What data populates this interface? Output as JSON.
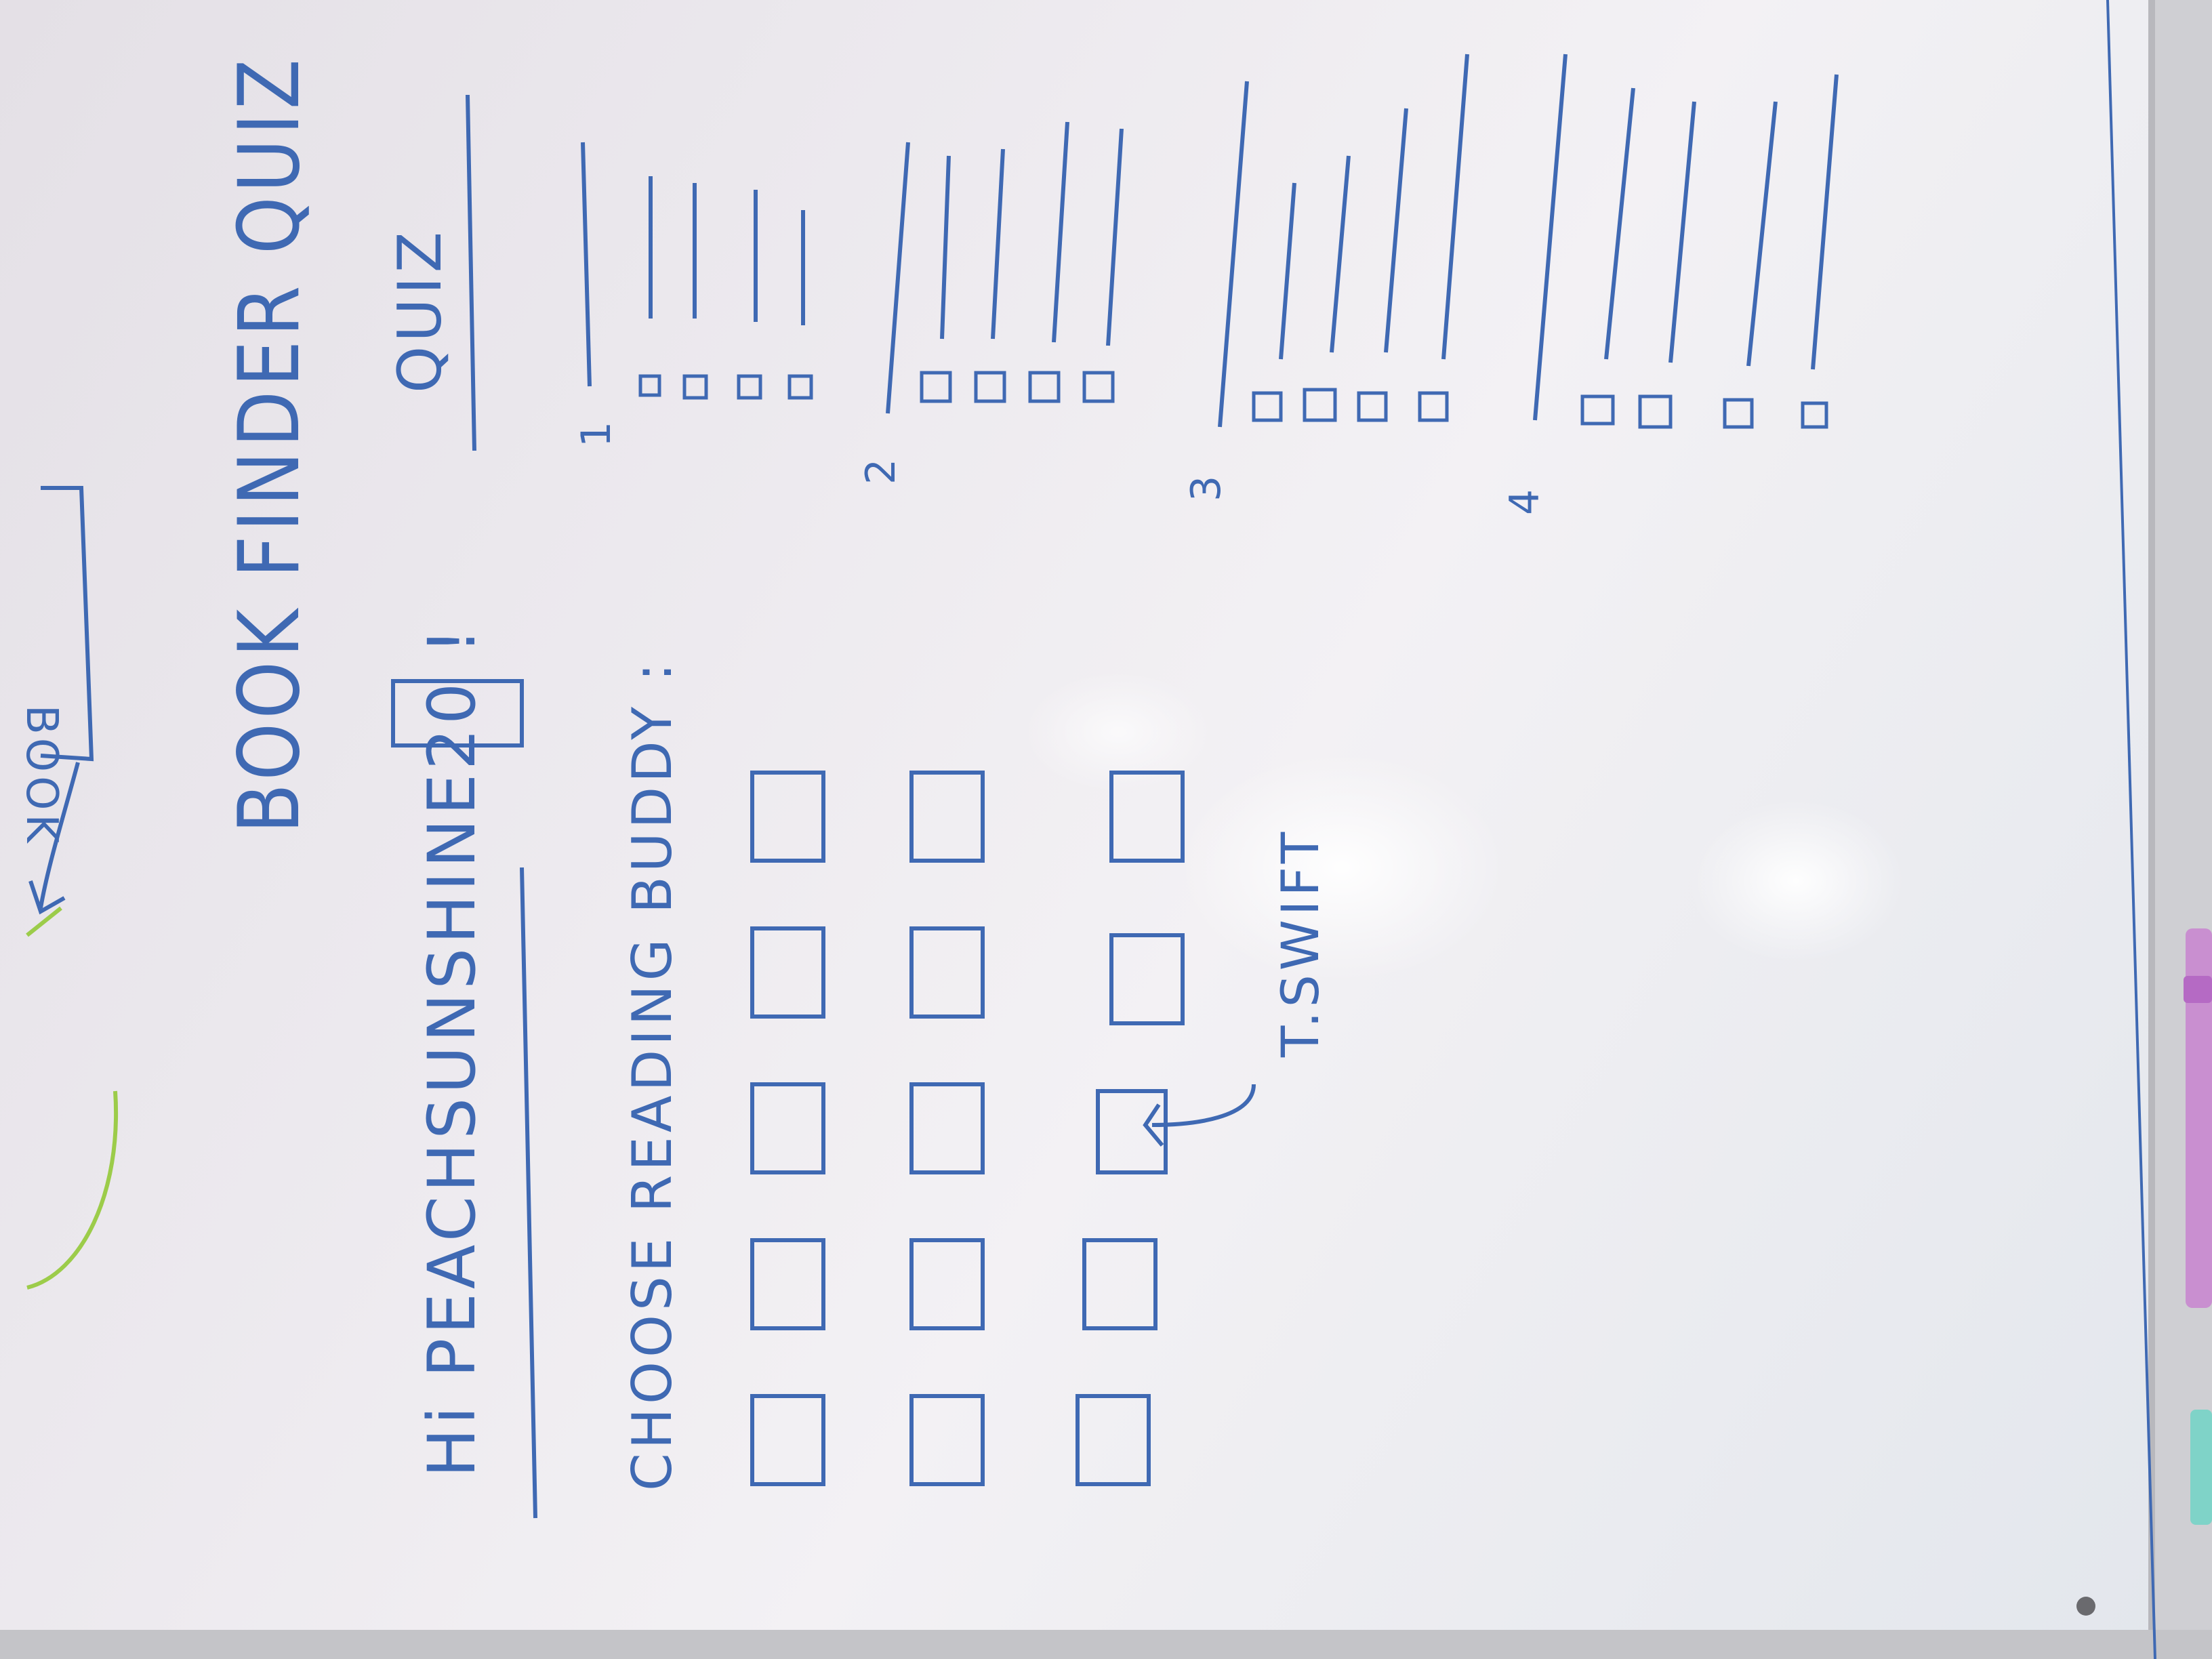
{
  "left_panel": {
    "title": "BOOK FINDER QUIZ",
    "greeting": "Hi PEACHSUNSHINE20 !",
    "prompt": "CHOOSE READING BUDDY :",
    "buddy_note": "T.SWIFT",
    "avatar_rows": 3,
    "avatar_cols": 5
  },
  "top_sketch": {
    "label": "BOOK"
  },
  "quiz_panel": {
    "title": "QUIZ",
    "questions": [
      {
        "number": "1",
        "answers": 4
      },
      {
        "number": "2",
        "answers": 4
      },
      {
        "number": "3",
        "answers": 4
      },
      {
        "number": "4",
        "answers": 4
      }
    ]
  },
  "colors": {
    "marker_blue": "#3f69b3",
    "marker_green": "#9ccc4a",
    "board": "#eceaee",
    "frame": "#c9c9cc",
    "tray_pink": "#c98fd0",
    "tray_teal": "#7fd3c8"
  }
}
